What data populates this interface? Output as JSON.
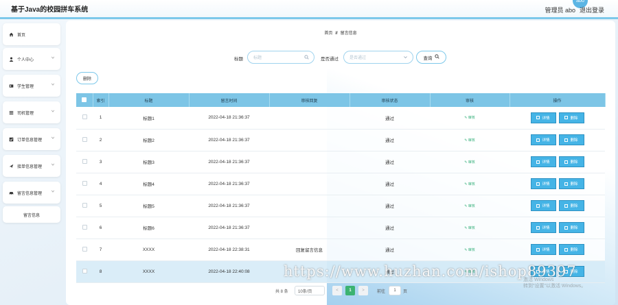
{
  "header": {
    "title": "基于Java的校园拼车系统",
    "user_label": "管理员 abo",
    "logout_label": "退出登录",
    "avatar_text": "abo"
  },
  "sidebar": {
    "items": [
      {
        "label": "首页",
        "icon": "home-icon"
      },
      {
        "label": "个人中心",
        "icon": "user-icon"
      },
      {
        "label": "学生管理",
        "icon": "student-icon"
      },
      {
        "label": "司机管理",
        "icon": "list-icon"
      },
      {
        "label": "订单信息管理",
        "icon": "checkbox-icon"
      },
      {
        "label": "接单信息管理",
        "icon": "plane-icon"
      },
      {
        "label": "留言信息管理",
        "icon": "car-icon"
      }
    ],
    "sub_item": "留言信息"
  },
  "breadcrumb": {
    "home": "首页",
    "separator": "//",
    "current": "留言信息"
  },
  "search": {
    "title_label": "标题",
    "title_placeholder": "标题",
    "approved_label": "是否通过",
    "approved_placeholder": "是否通过",
    "button_label": "查询"
  },
  "delete_all_label": "删除",
  "table": {
    "columns": [
      "索引",
      "标题",
      "留言时间",
      "审核回复",
      "审核状态",
      "审核",
      "操作"
    ],
    "audit_link_label": "审核",
    "detail_label": "详情",
    "delete_label": "删除",
    "rows": [
      {
        "index": "1",
        "title": "标题1",
        "time": "2022-04-18 21:36:37",
        "reply": "",
        "status": "通过"
      },
      {
        "index": "2",
        "title": "标题2",
        "time": "2022-04-18 21:36:37",
        "reply": "",
        "status": "通过"
      },
      {
        "index": "3",
        "title": "标题3",
        "time": "2022-04-18 21:36:37",
        "reply": "",
        "status": "通过"
      },
      {
        "index": "4",
        "title": "标题4",
        "time": "2022-04-18 21:36:37",
        "reply": "",
        "status": "通过"
      },
      {
        "index": "5",
        "title": "标题5",
        "time": "2022-04-18 21:36:37",
        "reply": "",
        "status": "通过"
      },
      {
        "index": "6",
        "title": "标题6",
        "time": "2022-04-18 21:36:37",
        "reply": "",
        "status": "通过"
      },
      {
        "index": "7",
        "title": "XXXX",
        "time": "2022-04-18 22:38:31",
        "reply": "回复留言信息",
        "status": "通过"
      },
      {
        "index": "8",
        "title": "XXXX",
        "time": "2022-04-18 22:40:08",
        "reply": "",
        "status": "通过"
      }
    ]
  },
  "pagination": {
    "total": "共 8 条",
    "page_size": "10条/页",
    "prev": "<",
    "current": "1",
    "next": ">",
    "goto_label": "前往",
    "goto_value": "1",
    "page_suffix": "页"
  },
  "watermark": {
    "text": "https://www.huzhan.com/ishop89397",
    "line1": "激活 Windows",
    "line2": "转到\"设置\"以激活 Windows。"
  }
}
